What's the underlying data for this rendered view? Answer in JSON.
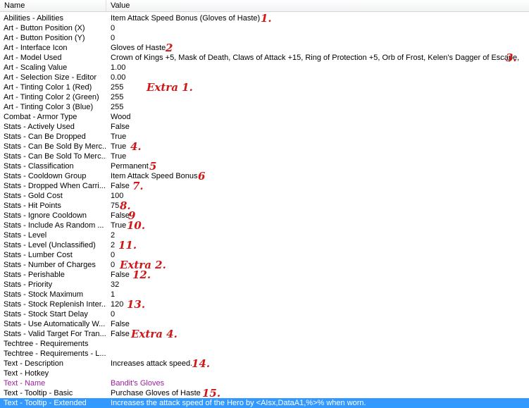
{
  "header": {
    "name_label": "Name",
    "value_label": "Value"
  },
  "rows": [
    {
      "name": "Abilities - Abilities",
      "value": "Item Attack Speed Bonus (Gloves of Haste)",
      "annotation": "1."
    },
    {
      "name": "Art - Button Position (X)",
      "value": "0",
      "annotation": ""
    },
    {
      "name": "Art - Button Position (Y)",
      "value": "0",
      "annotation": ""
    },
    {
      "name": "Art - Interface Icon",
      "value": "Gloves of Haste",
      "annotation": "2"
    },
    {
      "name": "Art - Model Used",
      "value": "Crown of Kings +5, Mask of Death, Claws of Attack +15, Ring of Protection +5, Orb of Frost, Kelen's Dagger of Escape,",
      "annotation": "3."
    },
    {
      "name": "Art - Scaling Value",
      "value": "1.00",
      "annotation": ""
    },
    {
      "name": "Art - Selection Size - Editor",
      "value": "0.00",
      "annotation": ""
    },
    {
      "name": "Art - Tinting Color 1 (Red)",
      "value": "255",
      "annotation": "Extra 1."
    },
    {
      "name": "Art - Tinting Color 2 (Green)",
      "value": "255",
      "annotation": ""
    },
    {
      "name": "Art - Tinting Color 3 (Blue)",
      "value": "255",
      "annotation": ""
    },
    {
      "name": "Combat - Armor Type",
      "value": "Wood",
      "annotation": ""
    },
    {
      "name": "Stats - Actively Used",
      "value": "False",
      "annotation": ""
    },
    {
      "name": "Stats - Can Be Dropped",
      "value": "True",
      "annotation": ""
    },
    {
      "name": "Stats - Can Be Sold By Merc...",
      "value": "True",
      "annotation": "4."
    },
    {
      "name": "Stats - Can Be Sold To Merc...",
      "value": "True",
      "annotation": ""
    },
    {
      "name": "Stats - Classification",
      "value": "Permanent",
      "annotation": "5"
    },
    {
      "name": "Stats - Cooldown Group",
      "value": "Item Attack Speed Bonus",
      "annotation": "6"
    },
    {
      "name": "Stats - Dropped When Carri...",
      "value": "False",
      "annotation": "7."
    },
    {
      "name": "Stats - Gold Cost",
      "value": "100",
      "annotation": ""
    },
    {
      "name": "Stats - Hit Points",
      "value": "75",
      "annotation": "8."
    },
    {
      "name": "Stats - Ignore Cooldown",
      "value": "False",
      "annotation": "9"
    },
    {
      "name": "Stats - Include As Random ...",
      "value": "True",
      "annotation": "10."
    },
    {
      "name": "Stats - Level",
      "value": "2",
      "annotation": ""
    },
    {
      "name": "Stats - Level (Unclassified)",
      "value": "2",
      "annotation": "11."
    },
    {
      "name": "Stats - Lumber Cost",
      "value": "0",
      "annotation": ""
    },
    {
      "name": "Stats - Number of Charges",
      "value": "0",
      "annotation": "Extra 2."
    },
    {
      "name": "Stats - Perishable",
      "value": "False",
      "annotation": "12."
    },
    {
      "name": "Stats - Priority",
      "value": "32",
      "annotation": ""
    },
    {
      "name": "Stats - Stock Maximum",
      "value": "1",
      "annotation": ""
    },
    {
      "name": "Stats - Stock Replenish Inter...",
      "value": "120",
      "annotation": "13."
    },
    {
      "name": "Stats - Stock Start Delay",
      "value": "0",
      "annotation": ""
    },
    {
      "name": "Stats - Use Automatically W...",
      "value": "False",
      "annotation": ""
    },
    {
      "name": "Stats - Valid Target For Tran...",
      "value": "False",
      "annotation": "Extra 4."
    },
    {
      "name": "Techtree - Requirements",
      "value": "",
      "annotation": ""
    },
    {
      "name": "Techtree - Requirements - L...",
      "value": "",
      "annotation": ""
    },
    {
      "name": "Text - Description",
      "value": "Increases attack speed.",
      "annotation": "14."
    },
    {
      "name": "Text - Hotkey",
      "value": "",
      "annotation": ""
    },
    {
      "name": "Text - Name",
      "value": "Bandit's Gloves",
      "annotation": "",
      "style": "purple"
    },
    {
      "name": "Text - Tooltip - Basic",
      "value": "Purchase Gloves of Haste",
      "annotation": "15."
    },
    {
      "name": "Text - Tooltip - Extended",
      "value": "Increases the attack speed of the Hero by <AIsx,DataA1,%>% when worn.",
      "annotation": "",
      "style": "selected"
    }
  ],
  "colors": {
    "annotation": "#d11616",
    "selection": "#3399ff",
    "modified_text": "#a020a0"
  }
}
